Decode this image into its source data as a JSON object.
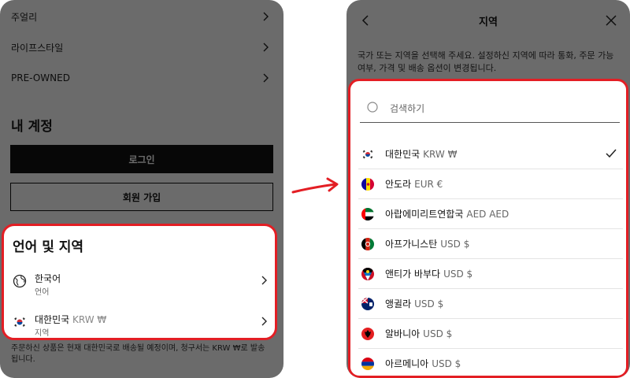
{
  "left": {
    "menu_items": [
      {
        "label": "주얼리"
      },
      {
        "label": "라이프스타일"
      },
      {
        "label": "PRE-OWNED"
      }
    ],
    "account_title": "내 계정",
    "login_label": "로그인",
    "join_label": "회원 가입",
    "lang_section": {
      "title": "언어 및 지역",
      "language": {
        "value": "한국어",
        "label": "언어"
      },
      "region": {
        "value": "대한민국",
        "currency": "KRW ₩",
        "label": "지역"
      }
    },
    "notice": "주문하신 상품은 현재 대한민국로 배송될 예정이며, 청구서는 KRW ₩로 발송됩니다."
  },
  "right": {
    "title": "지역",
    "description": "국가 또는 지역을 선택해 주세요. 설정하신 지역에 따라 통화, 주문 가능 여부, 가격 및 배송 옵션이 변경됩니다.",
    "search_placeholder": "검색하기",
    "countries": [
      {
        "name": "대한민국",
        "currency": "KRW ₩",
        "selected": true
      },
      {
        "name": "안도라",
        "currency": "EUR €",
        "selected": false
      },
      {
        "name": "아랍에미리트연합국",
        "currency": "AED AED",
        "selected": false
      },
      {
        "name": "아프가니스탄",
        "currency": "USD $",
        "selected": false
      },
      {
        "name": "앤티가 바부다",
        "currency": "USD $",
        "selected": false
      },
      {
        "name": "앵귈라",
        "currency": "USD $",
        "selected": false
      },
      {
        "name": "알바니아",
        "currency": "USD $",
        "selected": false
      },
      {
        "name": "아르메니아",
        "currency": "USD $",
        "selected": false
      }
    ]
  },
  "colors": {
    "highlight": "#e31e24",
    "overlay": "rgba(0,0,0,0.58)",
    "button_dark": "#111111"
  }
}
